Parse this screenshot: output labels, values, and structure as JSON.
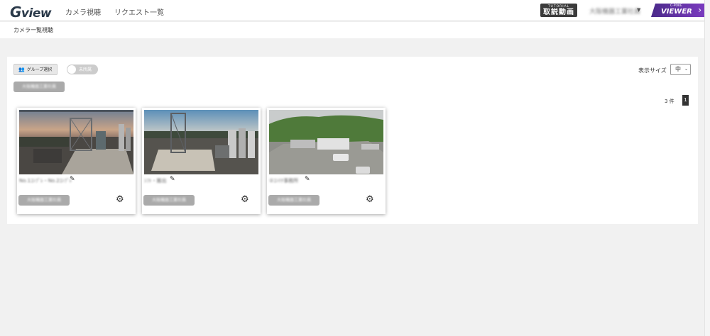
{
  "header": {
    "logo_g": "G",
    "logo_rest": "view",
    "nav": [
      "カメラ視聴",
      "リクエスト一覧"
    ],
    "tutorial_small": "TUTORIAL",
    "tutorial_main": "取説動画",
    "user_name": "大阪機器工業社員",
    "viewer_small": "C-POKE",
    "viewer_main": "VIEWER"
  },
  "breadcrumb": "カメラ一覧視聴",
  "toolbar": {
    "group_button": "グループ選択",
    "toggle_label": "未所属",
    "selected_group": "大阪機器工業社員",
    "size_label": "表示サイズ",
    "size_value": "中",
    "count": "3 件",
    "page": "1"
  },
  "cameras": [
    {
      "name": "No.1ｺﾝﾌﾟﾚ・No.2ｺﾝﾌﾟﾚ",
      "group": "大阪機器工業社員"
    },
    {
      "name": "ｼﾌﾄ・搬出",
      "group": "大阪機器工業社員"
    },
    {
      "name": "②ｺﾝﾃﾅ事務所",
      "group": "大阪機器工業社員"
    }
  ],
  "icons": {
    "group": "people-icon",
    "edit": "pencil-icon",
    "settings": "gear-icon",
    "dropdown": "caret-down-icon",
    "chevron": "chevron-right-icon"
  }
}
